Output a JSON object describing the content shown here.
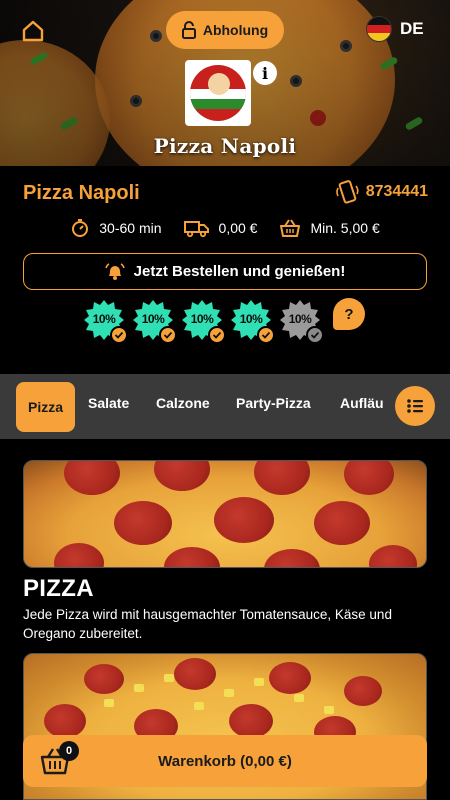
{
  "header": {
    "pickup_label": "Abholung",
    "language": "DE",
    "restaurant_logo_name": "Pizza Napoli"
  },
  "restaurant": {
    "name": "Pizza Napoli",
    "phone": "8734441",
    "delivery_time": "30-60 min",
    "delivery_fee": "0,00 €",
    "minimum_order": "Min. 5,00 €",
    "order_banner": "Jetzt Bestellen und genießen!"
  },
  "discounts": [
    {
      "label": "10%",
      "active": true
    },
    {
      "label": "10%",
      "active": true
    },
    {
      "label": "10%",
      "active": true
    },
    {
      "label": "10%",
      "active": true
    },
    {
      "label": "10%",
      "active": false
    }
  ],
  "help_label": "?",
  "categories": [
    {
      "label": "Pizza",
      "active": true
    },
    {
      "label": "Salate",
      "active": false
    },
    {
      "label": "Calzone",
      "active": false
    },
    {
      "label": "Party-Pizza",
      "active": false
    },
    {
      "label": "Aufläu",
      "active": false
    }
  ],
  "section": {
    "title": "PIZZA",
    "description": "Jede Pizza wird mit hausgemachter Tomatensauce, Käse und Oregano zubereitet."
  },
  "cart": {
    "label": "Warenkorb (0,00 €)",
    "count": "0"
  },
  "colors": {
    "accent": "#f6a13a",
    "badge_active": "#2fe0b4",
    "badge_inactive": "#9a9a9a",
    "category_bar": "#3a3a3a"
  },
  "icons": [
    "home-icon",
    "lock-icon",
    "flag-de-icon",
    "info-icon",
    "phone-icon",
    "timer-icon",
    "delivery-truck-icon",
    "basket-icon",
    "bell-icon",
    "check-icon",
    "list-icon",
    "cart-icon"
  ]
}
